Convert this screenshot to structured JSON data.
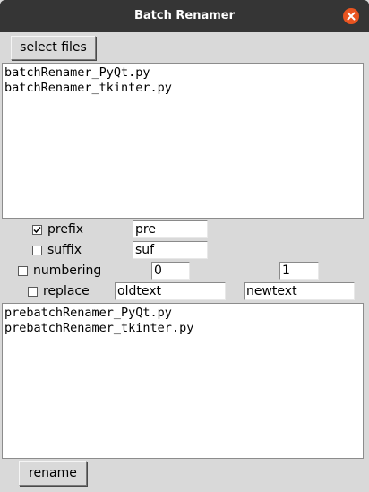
{
  "window": {
    "title": "Batch Renamer"
  },
  "toolbar": {
    "select_files_label": "select files",
    "rename_label": "rename"
  },
  "source_files": [
    "batchRenamer_PyQt.py",
    "batchRenamer_tkinter.py"
  ],
  "options": {
    "prefix": {
      "label": "prefix",
      "checked": true,
      "value": "pre"
    },
    "suffix": {
      "label": "suffix",
      "checked": false,
      "value": "suf"
    },
    "numbering": {
      "label": "numbering",
      "checked": false,
      "start": "0",
      "step": "1"
    },
    "replace": {
      "label": "replace",
      "checked": false,
      "old": "oldtext",
      "new": "newtext"
    }
  },
  "preview_files": [
    "prebatchRenamer_PyQt.py",
    "prebatchRenamer_tkinter.py"
  ],
  "colors": {
    "titlebar": "#353535",
    "close_button": "#e95420",
    "window_bg": "#d9d9d9"
  }
}
